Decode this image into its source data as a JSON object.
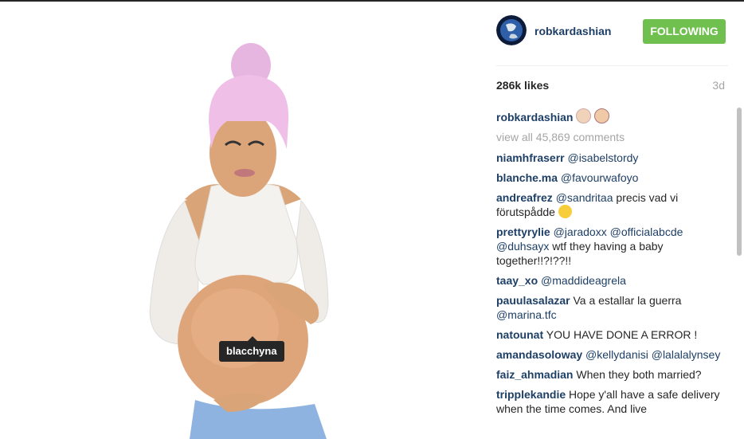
{
  "photo": {
    "tag_label": "blacchyna"
  },
  "header": {
    "username": "robkardashian",
    "follow_label": "FOLLOWING",
    "follow_color": "#70c050"
  },
  "stats": {
    "likes": "286k likes",
    "age": "3d"
  },
  "caption": {
    "username": "robkardashian",
    "emojis": [
      "baby-face-emoji",
      "bride-emoji"
    ]
  },
  "view_all": "view all 45,869 comments",
  "comments": [
    {
      "user": "niamhfraserr",
      "mention": "@isabelstordy",
      "text": ""
    },
    {
      "user": "blanche.ma",
      "mention": "@favourwafoyo",
      "text": ""
    },
    {
      "user": "andreafrez",
      "mention": "@sandritaa",
      "text": " precis vad vi förutspådde",
      "emoji": "relieved-face-emoji"
    },
    {
      "user": "prettyrylie",
      "mention": "@jaradoxx @officialabcde @duhsayx",
      "text": " wtf they having a baby together!!?!??!!"
    },
    {
      "user": "taay_xo",
      "mention": "@maddideagrela",
      "text": ""
    },
    {
      "user": "pauulasalazar",
      "mention": "",
      "text": " Va a estallar la guerra ",
      "mention2": "@marina.tfc"
    },
    {
      "user": "natounat",
      "mention": "",
      "text": " YOU HAVE DONE A ERROR !"
    },
    {
      "user": "amandasoloway",
      "mention": "@kellydanisi @lalalalynsey",
      "text": ""
    },
    {
      "user": "faiz_ahmadian",
      "mention": "",
      "text": " When they both married?"
    },
    {
      "user": "tripplekandie",
      "mention": "",
      "text": " Hope y'all have a safe delivery when the time comes. And live"
    }
  ],
  "colors": {
    "link": "#1e3f66",
    "muted": "#a5a5a5",
    "tag_bg": "#262626"
  }
}
